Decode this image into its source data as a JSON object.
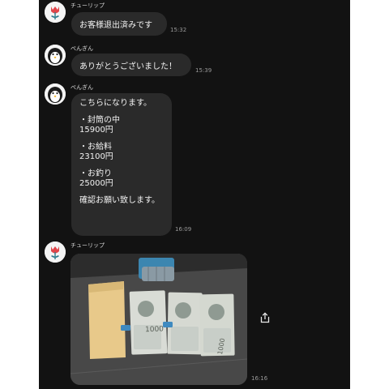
{
  "messages": [
    {
      "sender": "チューリップ",
      "avatar": "tulip-avatar",
      "text": "お客様退出済みです",
      "time": "15:32"
    },
    {
      "sender": "ぺんぎん",
      "avatar": "penguin-avatar",
      "text": "ありがとうございました！",
      "time": "15:39"
    },
    {
      "sender": "ぺんぎん",
      "avatar": "penguin-avatar",
      "time": "16:09",
      "lines": [
        "こちらになります。",
        "",
        "・封筒の中",
        "15900円",
        "",
        "・お給料",
        "23100円",
        "",
        "・お釣り",
        "25000円",
        "",
        "確認お願い致します。"
      ]
    },
    {
      "sender": "チューリップ",
      "avatar": "tulip-avatar",
      "time": "16:16",
      "attachment": "photo of envelope and banknotes"
    }
  ],
  "photo": {
    "banknote_text": "1000"
  },
  "icons": {
    "share": "share-icon"
  },
  "colors": {
    "chat_bg": "#121212",
    "bubble_bg": "#2a2a2a",
    "tulip_red": "#e0454a",
    "tulip_stem": "#2a7a8c"
  }
}
